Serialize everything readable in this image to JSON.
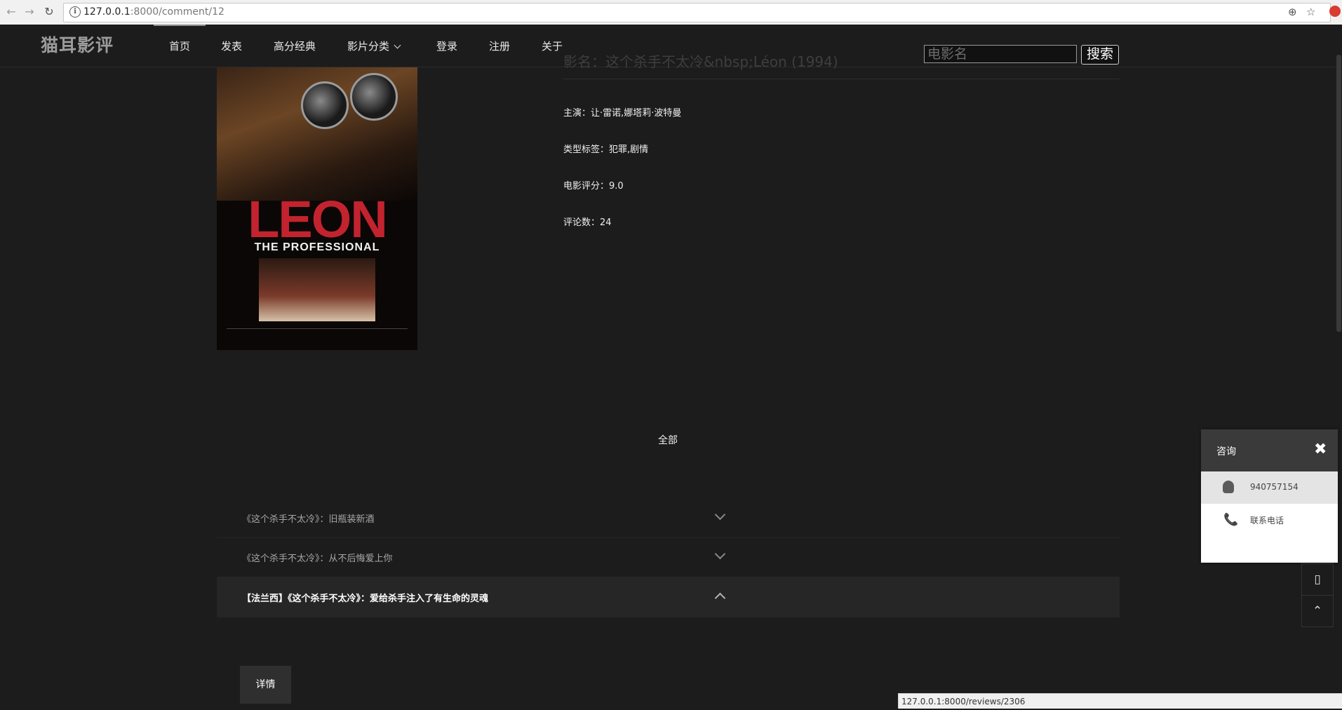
{
  "browser": {
    "url_host": "127.0.0.1",
    "url_rest": ":8000/comment/12",
    "status_url": "127.0.0.1:8000/reviews/2306"
  },
  "site": {
    "logo": "猫耳影评",
    "nav": [
      "首页",
      "发表",
      "高分经典",
      "影片分类",
      "登录",
      "注册",
      "关于"
    ],
    "search_placeholder": "电影名",
    "search_button": "搜索"
  },
  "movie": {
    "title": "影名：这个杀手不太冷&nbsp;Léon (1994)",
    "poster_title": "LEON",
    "poster_subtitle": "THE PROFESSIONAL",
    "cast": "主演：让·雷诺,娜塔莉·波特曼",
    "tags": "类型标签：犯罪,剧情",
    "rating": "电影评分：9.0",
    "review_count": "评论数：24"
  },
  "reviews": {
    "filter_label": "全部",
    "items": [
      "《这个杀手不太冷》：旧瓶装新酒",
      "《这个杀手不太冷》：从不后悔爱上你",
      "【法兰西】《这个杀手不太冷》：爱给杀手注入了有生命的灵魂"
    ],
    "detail_button": "详情"
  },
  "consult": {
    "title": "咨询",
    "close": "✖",
    "qq": "940757154",
    "phone": "联系电话"
  },
  "icons": {
    "back": "←",
    "forward": "→",
    "reload": "↻",
    "zoom": "⊕",
    "star": "☆",
    "phone": "📞",
    "mobile": "▯",
    "top": "⌃"
  }
}
